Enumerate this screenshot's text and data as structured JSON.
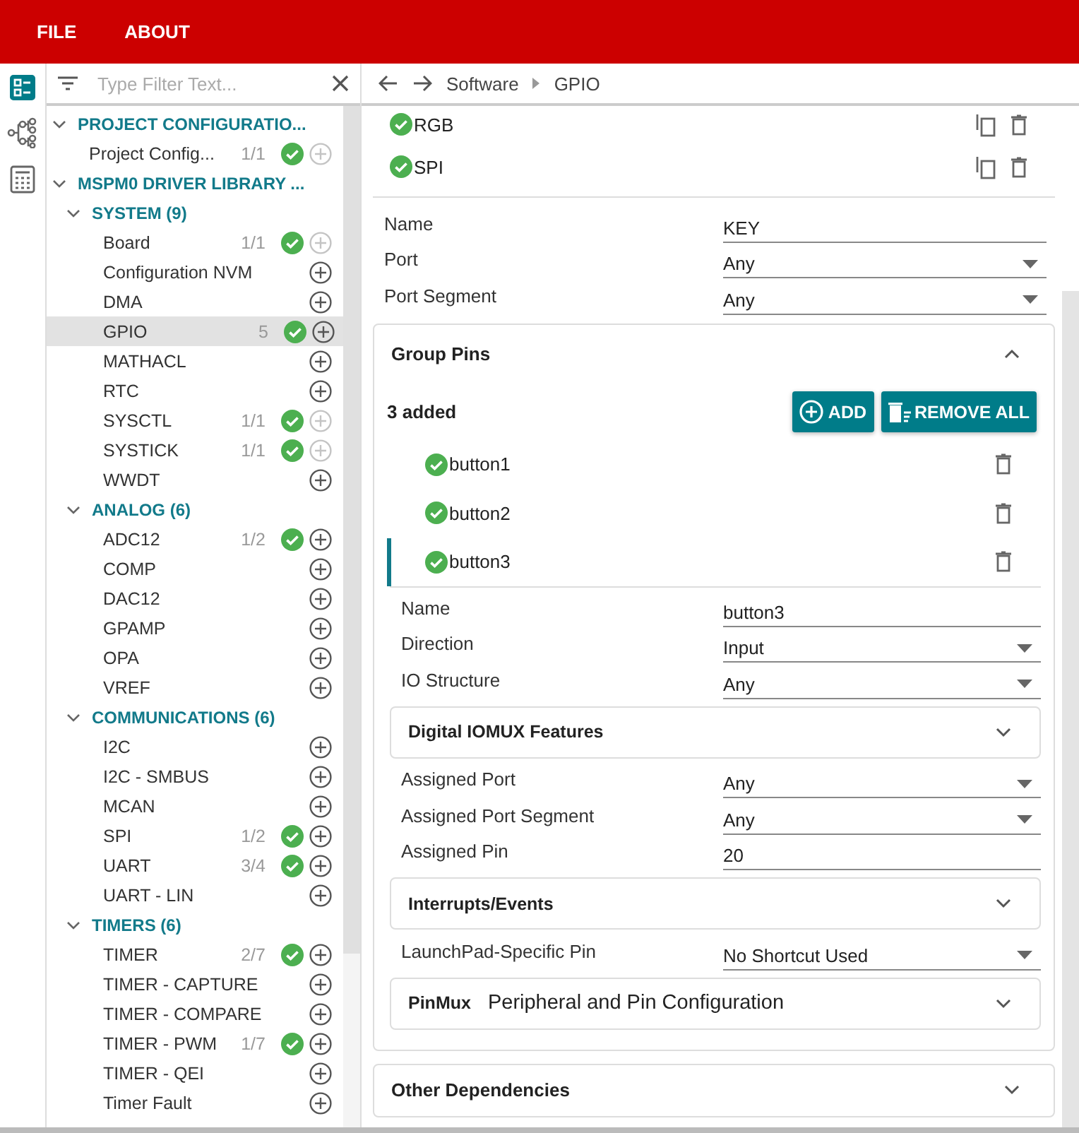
{
  "menu": [
    "FILE",
    "ABOUT"
  ],
  "rail": [
    {
      "selected": true
    },
    {
      "selected": false
    },
    {
      "selected": false
    }
  ],
  "filter": {
    "placeholder": "Type Filter Text..."
  },
  "tree": [
    {
      "kind": "category",
      "label": "PROJECT CONFIGURATIO...",
      "expanded": true,
      "children": [
        {
          "kind": "module",
          "label": "Project Config...",
          "count": "1/1",
          "valid": true,
          "add_disabled": true,
          "selected": false
        }
      ]
    },
    {
      "kind": "category",
      "label": "MSPM0 DRIVER LIBRARY ...",
      "expanded": true,
      "children": [
        {
          "kind": "category",
          "label": "SYSTEM (9)",
          "expanded": true,
          "children": [
            {
              "kind": "module",
              "label": "Board",
              "count": "1/1",
              "valid": true,
              "add_disabled": true,
              "selected": false
            },
            {
              "kind": "module",
              "label": "Configuration NVM",
              "valid": false,
              "add_disabled": false,
              "selected": false
            },
            {
              "kind": "module",
              "label": "DMA",
              "valid": false,
              "add_disabled": false,
              "selected": false
            },
            {
              "kind": "module",
              "label": "GPIO",
              "count": "5",
              "valid": true,
              "add_disabled": false,
              "selected": true
            },
            {
              "kind": "module",
              "label": "MATHACL",
              "valid": false,
              "add_disabled": false,
              "selected": false
            },
            {
              "kind": "module",
              "label": "RTC",
              "valid": false,
              "add_disabled": false,
              "selected": false
            },
            {
              "kind": "module",
              "label": "SYSCTL",
              "count": "1/1",
              "valid": true,
              "add_disabled": true,
              "selected": false
            },
            {
              "kind": "module",
              "label": "SYSTICK",
              "count": "1/1",
              "valid": true,
              "add_disabled": true,
              "selected": false
            },
            {
              "kind": "module",
              "label": "WWDT",
              "valid": false,
              "add_disabled": false,
              "selected": false
            }
          ]
        },
        {
          "kind": "category",
          "label": "ANALOG (6)",
          "expanded": true,
          "children": [
            {
              "kind": "module",
              "label": "ADC12",
              "count": "1/2",
              "valid": true,
              "add_disabled": false,
              "selected": false
            },
            {
              "kind": "module",
              "label": "COMP",
              "valid": false,
              "add_disabled": false,
              "selected": false
            },
            {
              "kind": "module",
              "label": "DAC12",
              "valid": false,
              "add_disabled": false,
              "selected": false
            },
            {
              "kind": "module",
              "label": "GPAMP",
              "valid": false,
              "add_disabled": false,
              "selected": false
            },
            {
              "kind": "module",
              "label": "OPA",
              "valid": false,
              "add_disabled": false,
              "selected": false
            },
            {
              "kind": "module",
              "label": "VREF",
              "valid": false,
              "add_disabled": false,
              "selected": false
            }
          ]
        },
        {
          "kind": "category",
          "label": "COMMUNICATIONS (6)",
          "expanded": true,
          "children": [
            {
              "kind": "module",
              "label": "I2C",
              "valid": false,
              "add_disabled": false,
              "selected": false
            },
            {
              "kind": "module",
              "label": "I2C - SMBUS",
              "valid": false,
              "add_disabled": false,
              "selected": false
            },
            {
              "kind": "module",
              "label": "MCAN",
              "valid": false,
              "add_disabled": false,
              "selected": false
            },
            {
              "kind": "module",
              "label": "SPI",
              "count": "1/2",
              "valid": true,
              "add_disabled": false,
              "selected": false
            },
            {
              "kind": "module",
              "label": "UART",
              "count": "3/4",
              "valid": true,
              "add_disabled": false,
              "selected": false
            },
            {
              "kind": "module",
              "label": "UART - LIN",
              "valid": false,
              "add_disabled": false,
              "selected": false
            }
          ]
        },
        {
          "kind": "category",
          "label": "TIMERS (6)",
          "expanded": true,
          "children": [
            {
              "kind": "module",
              "label": "TIMER",
              "count": "2/7",
              "valid": true,
              "add_disabled": false,
              "selected": false
            },
            {
              "kind": "module",
              "label": "TIMER - CAPTURE",
              "valid": false,
              "add_disabled": false,
              "selected": false
            },
            {
              "kind": "module",
              "label": "TIMER - COMPARE",
              "valid": false,
              "add_disabled": false,
              "selected": false
            },
            {
              "kind": "module",
              "label": "TIMER - PWM",
              "count": "1/7",
              "valid": true,
              "add_disabled": false,
              "selected": false
            },
            {
              "kind": "module",
              "label": "TIMER - QEI",
              "valid": false,
              "add_disabled": false,
              "selected": false
            },
            {
              "kind": "module",
              "label": "Timer Fault",
              "valid": false,
              "add_disabled": false,
              "selected": false
            }
          ]
        }
      ]
    }
  ],
  "breadcrumb": [
    "Software",
    "GPIO"
  ],
  "instances": [
    {
      "name": "RGB",
      "valid": true
    },
    {
      "name": "SPI",
      "valid": true
    }
  ],
  "fields": [
    {
      "kind": "text",
      "label": "Name",
      "value": "KEY"
    },
    {
      "kind": "select",
      "label": "Port",
      "value": "Any"
    },
    {
      "kind": "select",
      "label": "Port Segment",
      "value": "Any"
    }
  ],
  "group_pins": {
    "title": "Group Pins",
    "expanded": true,
    "count": "3 added",
    "add_button": "ADD",
    "remove_all_button": "REMOVE ALL",
    "pins": [
      {
        "name": "button1",
        "valid": true,
        "selected": false
      },
      {
        "name": "button2",
        "valid": true,
        "selected": false
      },
      {
        "name": "button3",
        "valid": true,
        "selected": true
      }
    ],
    "items": [
      {
        "kind": "text",
        "label": "Name",
        "value": "button3"
      },
      {
        "kind": "select",
        "label": "Direction",
        "value": "Input"
      },
      {
        "kind": "select",
        "label": "IO Structure",
        "value": "Any"
      },
      {
        "kind": "section",
        "title": "Digital IOMUX Features",
        "expanded": false
      },
      {
        "kind": "select",
        "label": "Assigned Port",
        "value": "Any"
      },
      {
        "kind": "select",
        "label": "Assigned Port Segment",
        "value": "Any"
      },
      {
        "kind": "text",
        "label": "Assigned Pin",
        "value": "20"
      },
      {
        "kind": "section",
        "title": "Interrupts/Events",
        "expanded": false
      },
      {
        "kind": "select",
        "label": "LaunchPad-Specific Pin",
        "value": "No Shortcut Used"
      },
      {
        "kind": "section",
        "title": "PinMux",
        "subtitle": "Peripheral and Pin Configuration",
        "expanded": false
      }
    ]
  },
  "other_sections": [
    {
      "title": "Other Dependencies",
      "expanded": false
    }
  ]
}
